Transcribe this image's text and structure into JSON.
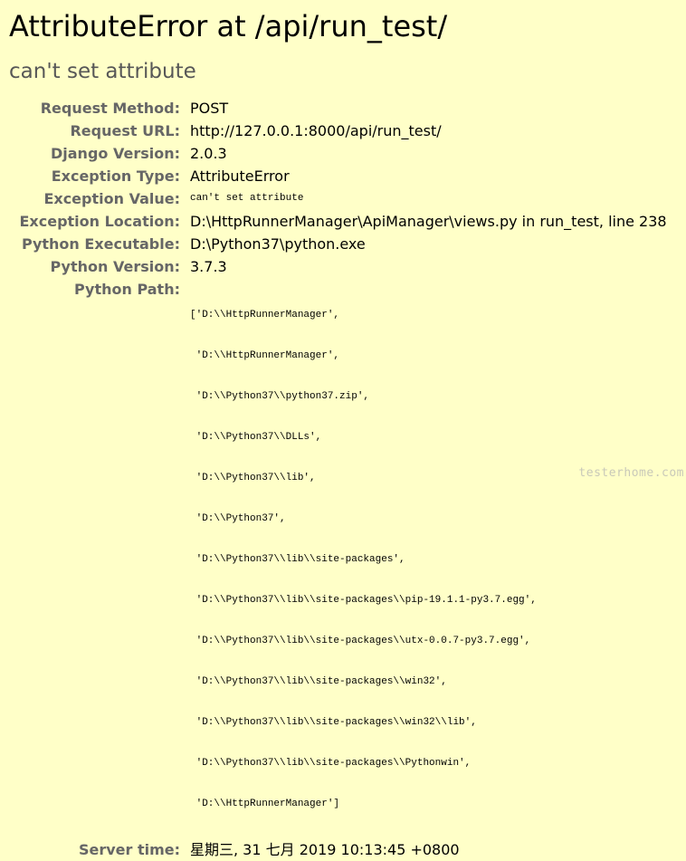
{
  "page": {
    "title": "AttributeError at /api/run_test/",
    "subtitle": "can't set attribute"
  },
  "details": [
    {
      "label": "Request Method:",
      "value": "POST"
    },
    {
      "label": "Request URL:",
      "value": "http://127.0.0.1:8000/api/run_test/"
    },
    {
      "label": "Django Version:",
      "value": "2.0.3"
    },
    {
      "label": "Exception Type:",
      "value": "AttributeError"
    },
    {
      "label": "Exception Value:",
      "value": "can't set attribute"
    },
    {
      "label": "Exception Location:",
      "value": "D:\\HttpRunnerManager\\ApiManager\\views.py in run_test, line 238"
    },
    {
      "label": "Python Executable:",
      "value": "D:\\Python37\\python.exe"
    },
    {
      "label": "Python Version:",
      "value": "3.7.3"
    },
    {
      "label": "Python Path:",
      "value": ""
    },
    {
      "label": "Server time:",
      "value": "星期三, 31 七月 2019 10:13:45 +0800"
    }
  ],
  "python_path": [
    "['D:\\\\HttpRunnerManager',",
    " 'D:\\\\HttpRunnerManager',",
    " 'D:\\\\Python37\\\\python37.zip',",
    " 'D:\\\\Python37\\\\DLLs',",
    " 'D:\\\\Python37\\\\lib',",
    " 'D:\\\\Python37',",
    " 'D:\\\\Python37\\\\lib\\\\site-packages',",
    " 'D:\\\\Python37\\\\lib\\\\site-packages\\\\pip-19.1.1-py3.7.egg',",
    " 'D:\\\\Python37\\\\lib\\\\site-packages\\\\utx-0.0.7-py3.7.egg',",
    " 'D:\\\\Python37\\\\lib\\\\site-packages\\\\win32',",
    " 'D:\\\\Python37\\\\lib\\\\site-packages\\\\win32\\\\lib',",
    " 'D:\\\\Python37\\\\lib\\\\site-packages\\\\Pythonwin',",
    " 'D:\\\\HttpRunnerManager']"
  ],
  "watermark": "testerhome.com"
}
